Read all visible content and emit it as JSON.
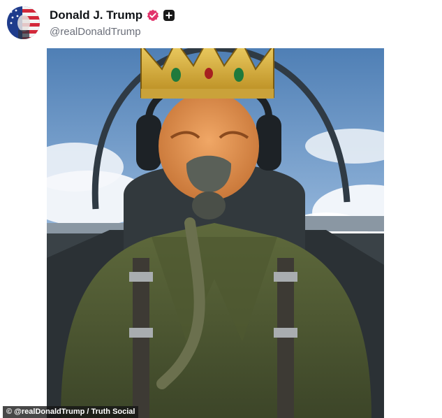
{
  "post": {
    "author": {
      "display_name": "Donald J. Trump",
      "handle": "@realDonaldTrump",
      "verified_color": "#e2336b"
    },
    "media": {
      "alt_subject": "image"
    },
    "credit_overlay": "© @realDonaldTrump / Truth Social"
  }
}
